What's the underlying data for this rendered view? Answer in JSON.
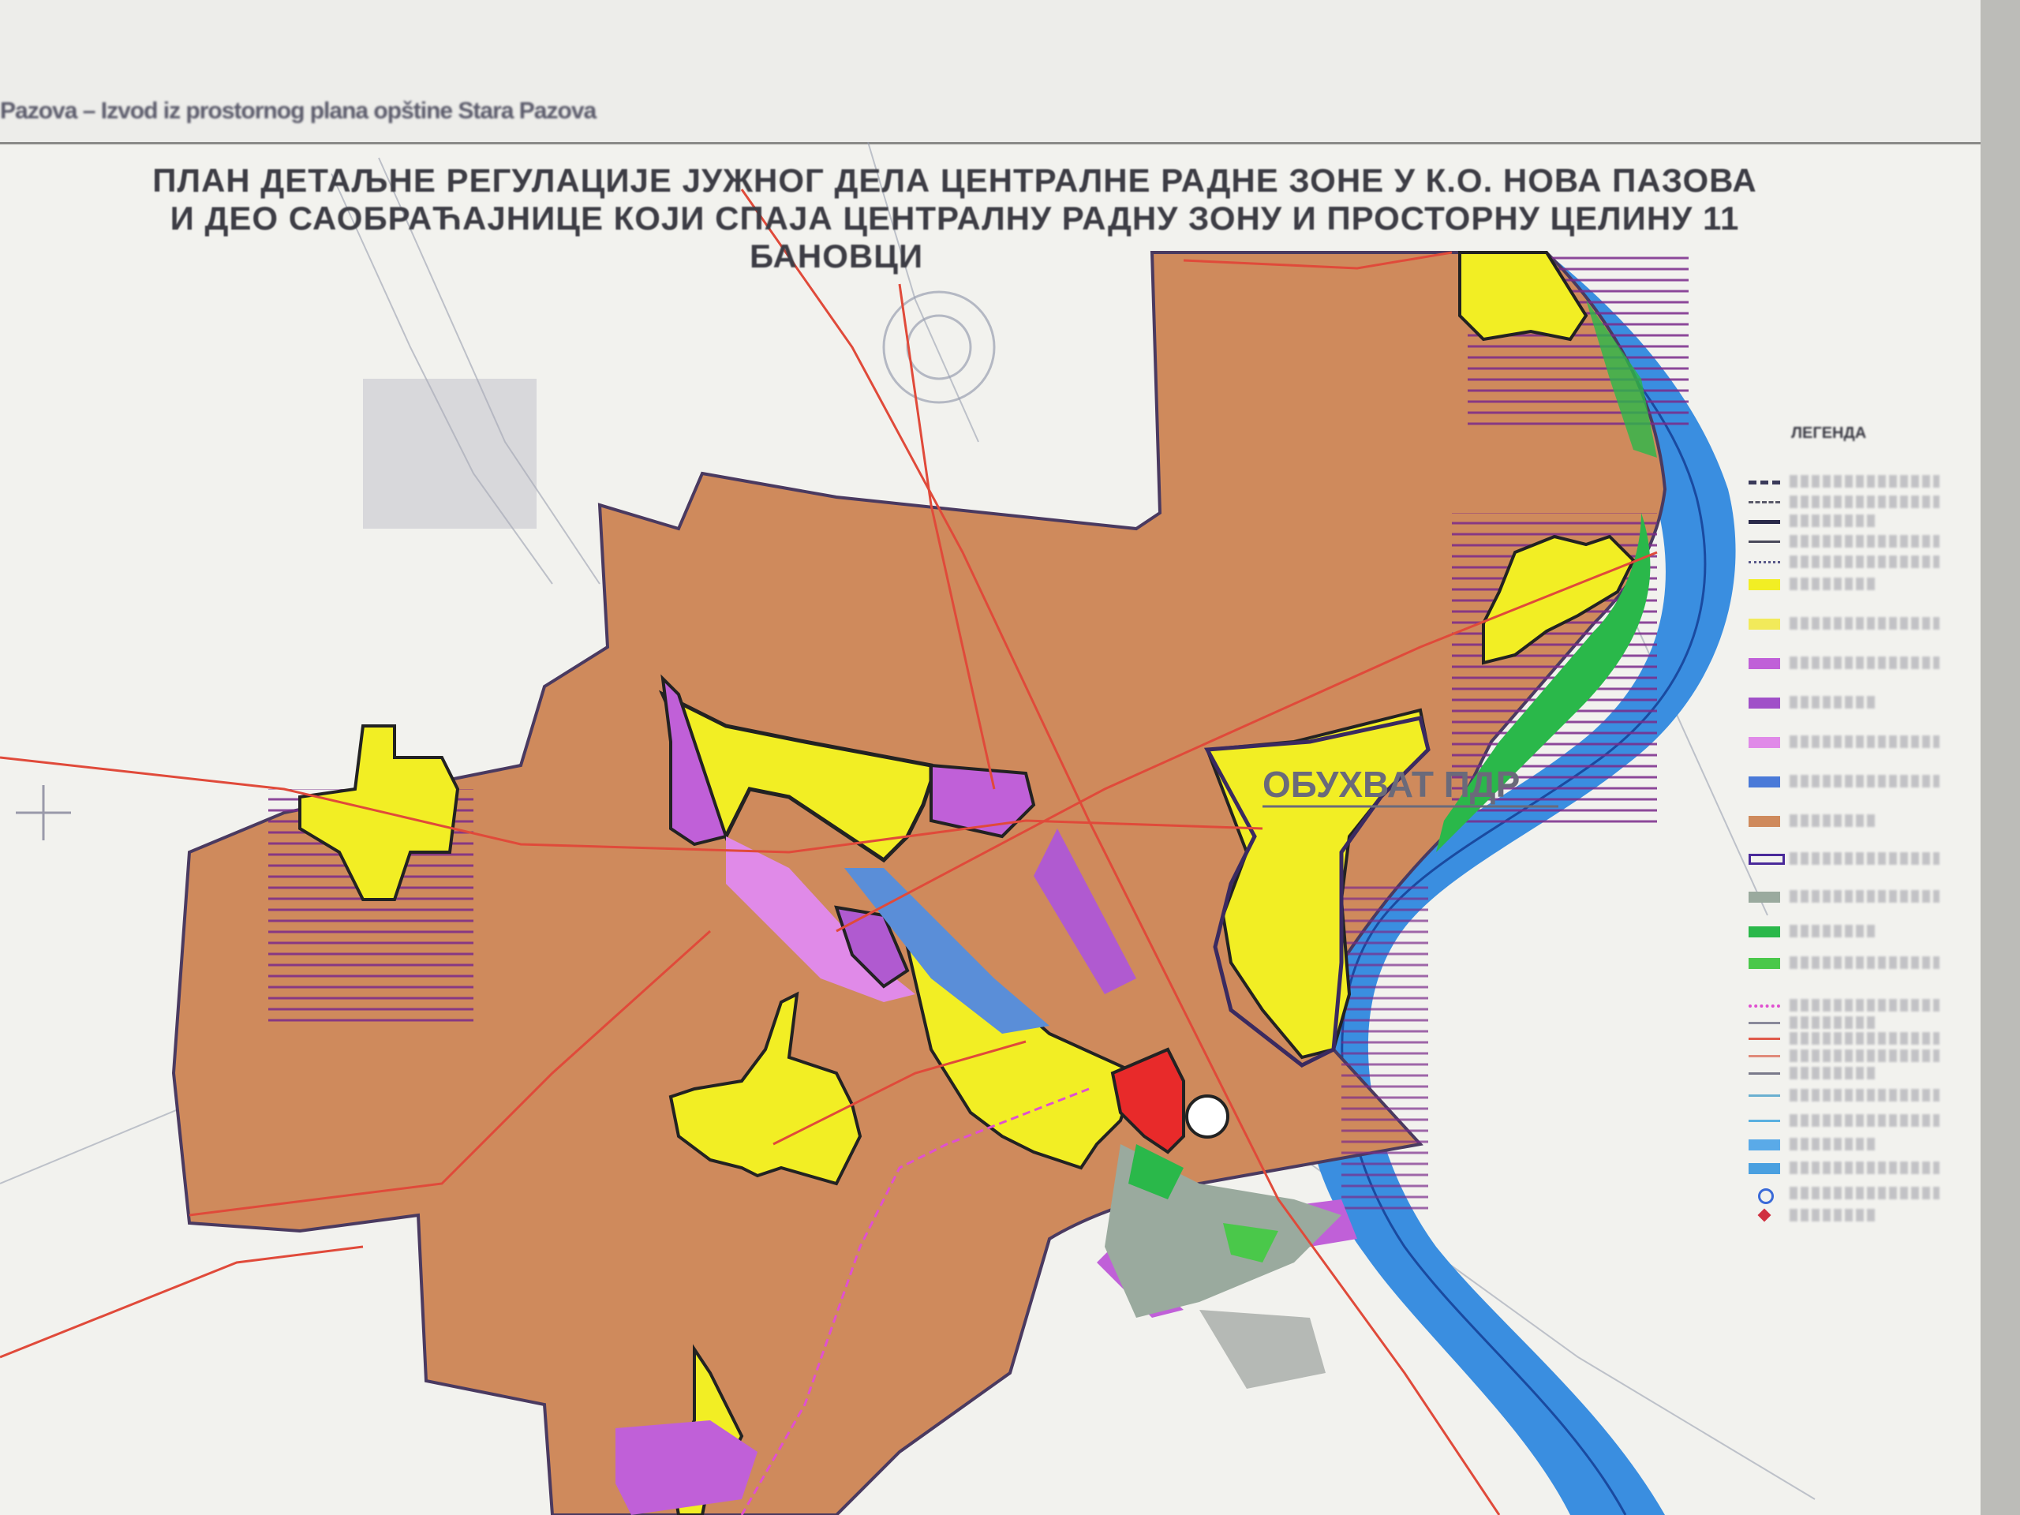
{
  "header": {
    "caption": "Pazova – Izvod iz prostornog plana opštine Stara Pazova"
  },
  "title": {
    "line1": "ПЛАН ДЕТАЉНЕ РЕГУЛАЦИЈЕ ЈУЖНОГ ДЕЛА ЦЕНТРАЛНЕ РАДНЕ ЗОНЕ У К.О. НОВА ПАЗОВА",
    "line2": "И ДЕО САОБРАЋАЈНИЦЕ КОЈИ СПАЈА ЦЕНТРАЛНУ РАДНУ ЗОНУ И ПРОСТОРНУ ЦЕЛИНУ 11",
    "line3": "БАНОВЦИ"
  },
  "map": {
    "boundary_label": "ОБУХВАТ ПДР",
    "colors": {
      "agricultural": "#cf8a5c",
      "settlement": "#f2ee24",
      "industry_light": "#d98ae0",
      "industry_dark": "#b05ad0",
      "corridor": "#5a8ed8",
      "forest": "#2ab84a",
      "green_gray": "#9aaa9e",
      "river": "#3a8ee0",
      "hatch": "#7a2a8a",
      "boundary": "#3a2a60",
      "road": "#e04a3a",
      "rail": "#e050d0",
      "background": "#f2f2ee"
    }
  },
  "legend": {
    "title": "ЛЕГЕНДА",
    "items": [
      {
        "symbol": "dash-thick",
        "color": "#3a3a5a"
      },
      {
        "symbol": "dash",
        "color": "#5a5a6a"
      },
      {
        "symbol": "solid-thick",
        "color": "#2a2a4a"
      },
      {
        "symbol": "solid",
        "color": "#4a4a5a"
      },
      {
        "symbol": "dash-dot",
        "color": "#5a5a8a"
      },
      {
        "symbol": "fill",
        "color": "#f2ee24"
      },
      {
        "symbol": "fill",
        "color": "#f2ea5a"
      },
      {
        "symbol": "fill",
        "color": "#c060d8"
      },
      {
        "symbol": "fill",
        "color": "#a050c8"
      },
      {
        "symbol": "fill",
        "color": "#e08ae8"
      },
      {
        "symbol": "fill",
        "color": "#4a7ad8"
      },
      {
        "symbol": "fill",
        "color": "#cf8a5c"
      },
      {
        "symbol": "outline",
        "color": "#4a2a9a"
      },
      {
        "symbol": "fill",
        "color": "#9aaa9e"
      },
      {
        "symbol": "fill",
        "color": "#2ab84a"
      },
      {
        "symbol": "fill",
        "color": "#4ac84a"
      },
      {
        "symbol": "dotted",
        "color": "#e050d0"
      },
      {
        "symbol": "line",
        "color": "#8a8a9a"
      },
      {
        "symbol": "line",
        "color": "#e05a4a"
      },
      {
        "symbol": "line",
        "color": "#e08a7a"
      },
      {
        "symbol": "line",
        "color": "#7a7a8a"
      },
      {
        "symbol": "line",
        "color": "#6ab0d0"
      },
      {
        "symbol": "line",
        "color": "#5ab0e0"
      },
      {
        "symbol": "fill",
        "color": "#5aaae8"
      },
      {
        "symbol": "fill",
        "color": "#4aa0e0"
      },
      {
        "symbol": "circle",
        "color": "#3a6ad8"
      },
      {
        "symbol": "star",
        "color": "#d03040"
      }
    ]
  }
}
